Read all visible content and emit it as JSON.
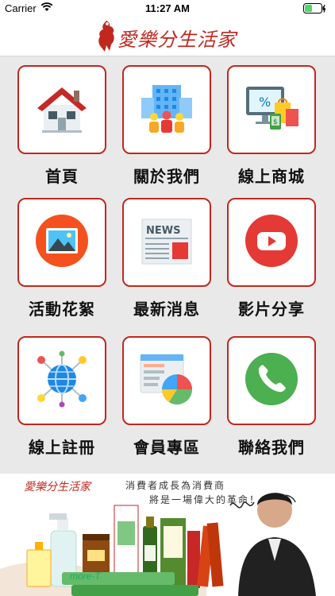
{
  "status_bar": {
    "carrier": "Carrier",
    "time": "11:27 AM"
  },
  "header": {
    "logo_text": "愛樂分生活家"
  },
  "menu": [
    {
      "label": "首頁",
      "icon": "home-icon"
    },
    {
      "label": "關於我們",
      "icon": "building-people-icon"
    },
    {
      "label": "線上商城",
      "icon": "online-shop-icon"
    },
    {
      "label": "活動花絮",
      "icon": "photo-icon"
    },
    {
      "label": "最新消息",
      "icon": "newspaper-icon"
    },
    {
      "label": "影片分享",
      "icon": "video-play-icon"
    },
    {
      "label": "線上註冊",
      "icon": "network-globe-icon"
    },
    {
      "label": "會員專區",
      "icon": "report-chart-icon"
    },
    {
      "label": "聯絡我們",
      "icon": "phone-icon"
    }
  ],
  "banner": {
    "logo_text": "愛樂分生活家",
    "slogan_line1": "消費者成長為消費商",
    "slogan_line2": "將是一場偉大的革命！",
    "product_text": "more-T"
  },
  "colors": {
    "accent": "#c0281e",
    "grid_background": "#e9e9e9"
  }
}
